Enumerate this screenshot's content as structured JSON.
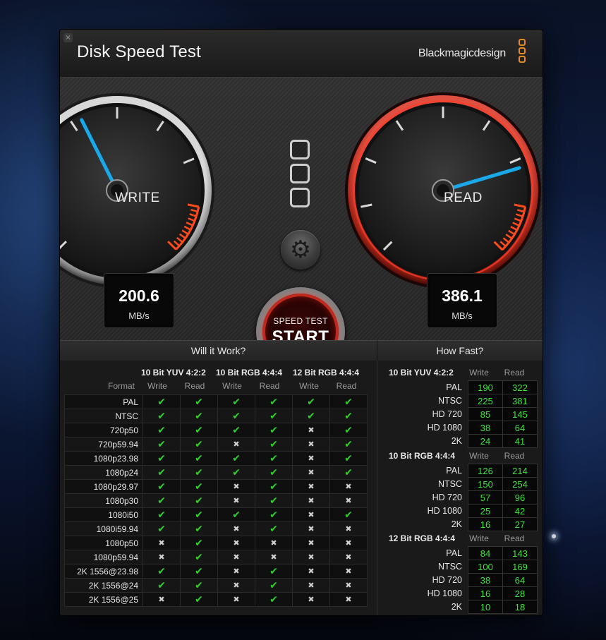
{
  "window": {
    "title": "Disk Speed Test",
    "brand": "Blackmagicdesign",
    "close_glyph": "×"
  },
  "gauges": {
    "write": {
      "label": "WRITE",
      "value": "200.6",
      "unit": "MB/s"
    },
    "read": {
      "label": "READ",
      "value": "386.1",
      "unit": "MB/s"
    }
  },
  "controls": {
    "settings_icon": "gear-icon",
    "start_small": "SPEED TEST",
    "start_big": "START"
  },
  "will_it_work": {
    "title": "Will it Work?",
    "format_label": "Format",
    "groups": [
      {
        "name": "10 Bit YUV 4:2:2",
        "write": "Write",
        "read": "Read"
      },
      {
        "name": "10 Bit RGB 4:4:4",
        "write": "Write",
        "read": "Read"
      },
      {
        "name": "12 Bit RGB 4:4:4",
        "write": "Write",
        "read": "Read"
      }
    ],
    "yes_glyph": "✔",
    "no_glyph": "✖",
    "rows": [
      {
        "format": "PAL",
        "cells": [
          1,
          1,
          1,
          1,
          1,
          1
        ]
      },
      {
        "format": "NTSC",
        "cells": [
          1,
          1,
          1,
          1,
          1,
          1
        ]
      },
      {
        "format": "720p50",
        "cells": [
          1,
          1,
          1,
          1,
          0,
          1
        ]
      },
      {
        "format": "720p59.94",
        "cells": [
          1,
          1,
          0,
          1,
          0,
          1
        ]
      },
      {
        "format": "1080p23.98",
        "cells": [
          1,
          1,
          1,
          1,
          0,
          1
        ]
      },
      {
        "format": "1080p24",
        "cells": [
          1,
          1,
          1,
          1,
          0,
          1
        ]
      },
      {
        "format": "1080p29.97",
        "cells": [
          1,
          1,
          0,
          1,
          0,
          0
        ]
      },
      {
        "format": "1080p30",
        "cells": [
          1,
          1,
          0,
          1,
          0,
          0
        ]
      },
      {
        "format": "1080i50",
        "cells": [
          1,
          1,
          1,
          1,
          0,
          1
        ]
      },
      {
        "format": "1080i59.94",
        "cells": [
          1,
          1,
          0,
          1,
          0,
          0
        ]
      },
      {
        "format": "1080p50",
        "cells": [
          0,
          1,
          0,
          0,
          0,
          0
        ]
      },
      {
        "format": "1080p59.94",
        "cells": [
          0,
          1,
          0,
          0,
          0,
          0
        ]
      },
      {
        "format": "2K 1556@23.98",
        "cells": [
          1,
          1,
          0,
          1,
          0,
          0
        ]
      },
      {
        "format": "2K 1556@24",
        "cells": [
          1,
          1,
          0,
          1,
          0,
          0
        ]
      },
      {
        "format": "2K 1556@25",
        "cells": [
          0,
          1,
          0,
          1,
          0,
          0
        ]
      }
    ]
  },
  "how_fast": {
    "title": "How Fast?",
    "groups": [
      {
        "name": "10 Bit YUV 4:2:2",
        "write": "Write",
        "read": "Read",
        "rows": [
          {
            "label": "PAL",
            "write": "190",
            "read": "322"
          },
          {
            "label": "NTSC",
            "write": "225",
            "read": "381"
          },
          {
            "label": "HD 720",
            "write": "85",
            "read": "145"
          },
          {
            "label": "HD 1080",
            "write": "38",
            "read": "64"
          },
          {
            "label": "2K",
            "write": "24",
            "read": "41"
          }
        ]
      },
      {
        "name": "10 Bit RGB 4:4:4",
        "write": "Write",
        "read": "Read",
        "rows": [
          {
            "label": "PAL",
            "write": "126",
            "read": "214"
          },
          {
            "label": "NTSC",
            "write": "150",
            "read": "254"
          },
          {
            "label": "HD 720",
            "write": "57",
            "read": "96"
          },
          {
            "label": "HD 1080",
            "write": "25",
            "read": "42"
          },
          {
            "label": "2K",
            "write": "16",
            "read": "27"
          }
        ]
      },
      {
        "name": "12 Bit RGB 4:4:4",
        "write": "Write",
        "read": "Read",
        "rows": [
          {
            "label": "PAL",
            "write": "84",
            "read": "143"
          },
          {
            "label": "NTSC",
            "write": "100",
            "read": "169"
          },
          {
            "label": "HD 720",
            "write": "38",
            "read": "64"
          },
          {
            "label": "HD 1080",
            "write": "16",
            "read": "28"
          },
          {
            "label": "2K",
            "write": "10",
            "read": "18"
          }
        ]
      }
    ]
  }
}
